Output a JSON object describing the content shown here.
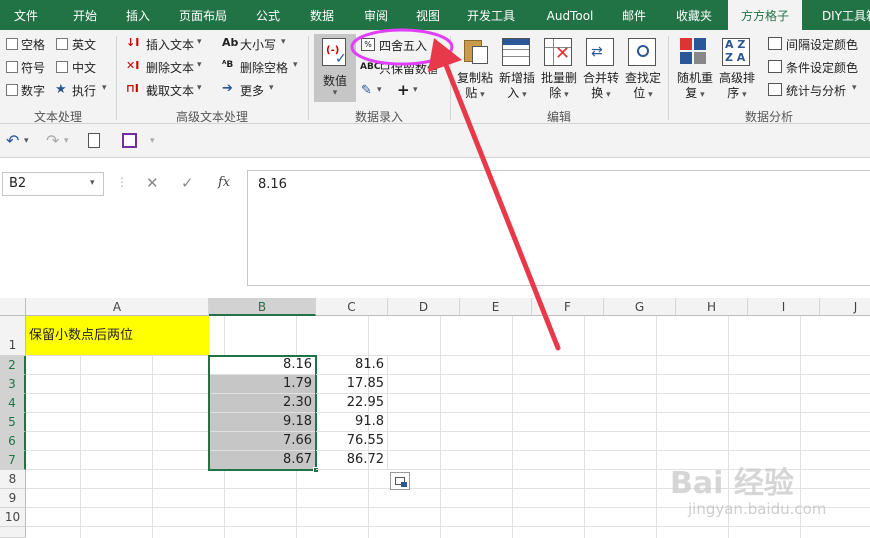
{
  "tabs": [
    "文件",
    "开始",
    "插入",
    "页面布局",
    "公式",
    "数据",
    "审阅",
    "视图",
    "开发工具",
    "AudTool",
    "邮件",
    "收藏夹",
    "方方格子",
    "DIY工具箱"
  ],
  "active_tab": "方方格子",
  "ribbon": {
    "text_process": {
      "items": [
        "空格",
        "英文",
        "符号",
        "中文",
        "数字",
        "执行"
      ],
      "group": "文本处理"
    },
    "adv_text": {
      "items": [
        "插入文本",
        "删除文本",
        "截取文本",
        "大小写",
        "删除空格",
        "更多"
      ],
      "group": "高级文本处理"
    },
    "num_entry": {
      "big": "数值",
      "items": [
        "四舍五入",
        "只保留数值"
      ],
      "group": "数据录入"
    },
    "edit": {
      "items": [
        [
          "复制粘",
          "贴"
        ],
        [
          "新增插",
          "入"
        ],
        [
          "批量删",
          "除"
        ],
        [
          "合并转",
          "换"
        ],
        [
          "查找定",
          "位"
        ]
      ],
      "group": "编辑"
    },
    "analysis": {
      "items": [
        [
          "随机重",
          "复"
        ],
        [
          "高级排",
          "序"
        ]
      ],
      "small": [
        "间隔设定颜色",
        "条件设定颜色",
        "统计与分析"
      ],
      "group": "数据分析"
    }
  },
  "formula_bar": {
    "name_box": "B2",
    "value": "8.16"
  },
  "columns": [
    "A",
    "B",
    "C",
    "D",
    "E",
    "F",
    "G",
    "H",
    "I",
    "J"
  ],
  "rows": [
    "1",
    "2",
    "3",
    "4",
    "5",
    "6",
    "7",
    "8",
    "9",
    "10"
  ],
  "cells": {
    "A1": "保留小数点后两位",
    "B": [
      "8.16",
      "1.79",
      "2.30",
      "9.18",
      "7.66",
      "8.67"
    ],
    "C": [
      "81.6",
      "17.85",
      "22.95",
      "91.8",
      "76.55",
      "86.72"
    ]
  },
  "watermark": {
    "brand": "Bai  经验",
    "url": "jingyan.baidu.com"
  },
  "colors": {
    "accent": "#217346",
    "highlight": "#ffff00",
    "annotation_circle": "#e040fb",
    "arrow": "#e8394a"
  }
}
